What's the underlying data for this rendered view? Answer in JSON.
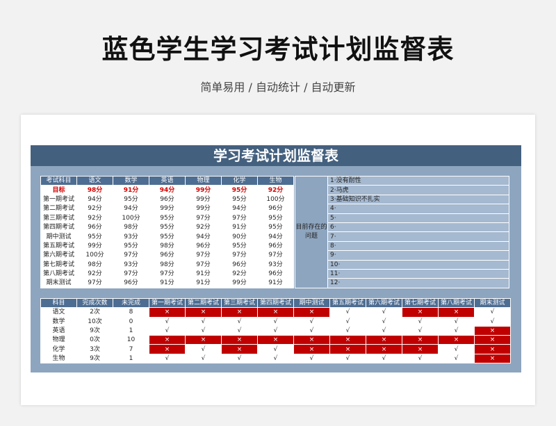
{
  "header": {
    "title": "蓝色学生学习考试计划监督表",
    "subtitle": "简单易用 / 自动统计 / 自动更新"
  },
  "sheet": {
    "title": "学习考试计划监督表"
  },
  "scores": {
    "headers": [
      "考试科目",
      "语文",
      "数学",
      "英语",
      "物理",
      "化学",
      "生物"
    ],
    "target": [
      "目标",
      "98分",
      "91分",
      "94分",
      "99分",
      "95分",
      "92分"
    ],
    "rows": [
      [
        "第一期考试",
        "94分",
        "95分",
        "96分",
        "99分",
        "95分",
        "100分"
      ],
      [
        "第二期考试",
        "92分",
        "94分",
        "99分",
        "99分",
        "94分",
        "96分"
      ],
      [
        "第三期考试",
        "92分",
        "100分",
        "95分",
        "97分",
        "97分",
        "95分"
      ],
      [
        "第四期考试",
        "96分",
        "98分",
        "95分",
        "92分",
        "91分",
        "95分"
      ],
      [
        "期中测试",
        "95分",
        "93分",
        "95分",
        "94分",
        "90分",
        "94分"
      ],
      [
        "第五期考试",
        "99分",
        "95分",
        "98分",
        "96分",
        "95分",
        "96分"
      ],
      [
        "第六期考试",
        "100分",
        "97分",
        "96分",
        "97分",
        "97分",
        "97分"
      ],
      [
        "第七期考试",
        "98分",
        "93分",
        "98分",
        "97分",
        "96分",
        "93分"
      ],
      [
        "第八期考试",
        "92分",
        "97分",
        "97分",
        "91分",
        "92分",
        "96分"
      ],
      [
        "期末测试",
        "97分",
        "96分",
        "91分",
        "91分",
        "99分",
        "91分"
      ]
    ]
  },
  "problems": {
    "label": "目前存在的问题",
    "items": [
      "1·没有耐性",
      "2·马虎",
      "3·基础知识不扎实",
      "4·",
      "5·",
      "6·",
      "7·",
      "8·",
      "9·",
      "10·",
      "11·",
      "12·"
    ]
  },
  "completion": {
    "headers": [
      "科目",
      "完成次数",
      "未完成",
      "第一期考试",
      "第二期考试",
      "第三期考试",
      "第四期考试",
      "期中测试",
      "第五期考试",
      "第六期考试",
      "第七期考试",
      "第八期考试",
      "期末测试"
    ],
    "rows": [
      [
        "语文",
        "2次",
        "8",
        "×",
        "×",
        "×",
        "×",
        "×",
        "√",
        "√",
        "×",
        "×",
        "√"
      ],
      [
        "数学",
        "10次",
        "0",
        "√",
        "√",
        "√",
        "√",
        "√",
        "√",
        "√",
        "√",
        "√",
        "√"
      ],
      [
        "英语",
        "9次",
        "1",
        "√",
        "√",
        "√",
        "√",
        "√",
        "√",
        "√",
        "√",
        "√",
        "×"
      ],
      [
        "物理",
        "0次",
        "10",
        "×",
        "×",
        "×",
        "×",
        "×",
        "×",
        "×",
        "×",
        "×",
        "×"
      ],
      [
        "化学",
        "3次",
        "7",
        "×",
        "√",
        "×",
        "√",
        "×",
        "×",
        "×",
        "×",
        "√",
        "×"
      ],
      [
        "生物",
        "9次",
        "1",
        "√",
        "√",
        "√",
        "√",
        "√",
        "√",
        "√",
        "√",
        "√",
        "×"
      ]
    ]
  },
  "colors": {
    "header_blue": "#44607f",
    "sheet_bg": "#8ea5bf",
    "fail_red": "#c00000",
    "target_red": "#d50000"
  }
}
